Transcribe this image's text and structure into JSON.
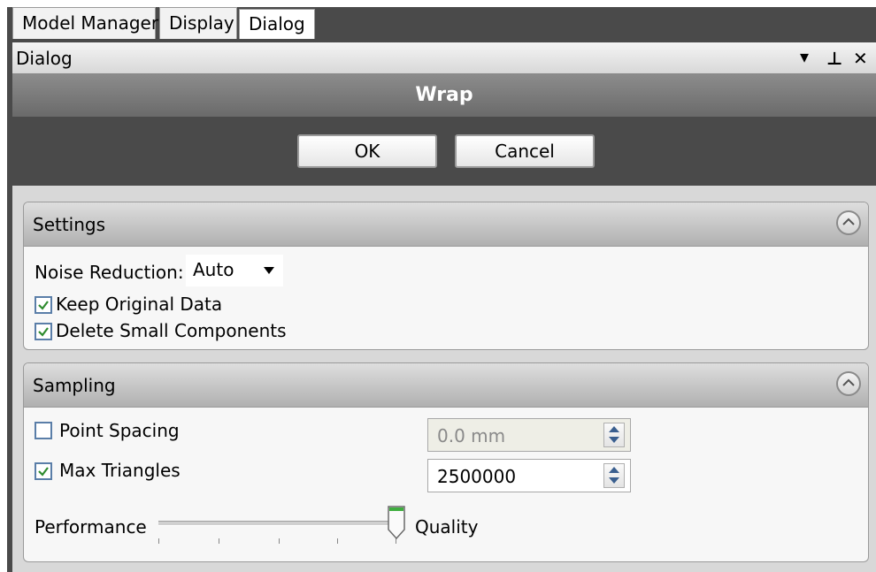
{
  "tabs": [
    {
      "label": "Model Manager"
    },
    {
      "label": "Display"
    },
    {
      "label": "Dialog"
    }
  ],
  "window": {
    "title": "Dialog",
    "dropdown_glyph": "▾",
    "pin_glyph": "⊥",
    "close_glyph": "✕"
  },
  "dialog": {
    "title": "Wrap"
  },
  "buttons": {
    "ok_label": "OK",
    "cancel_label": "Cancel"
  },
  "settings": {
    "header": "Settings",
    "noise_reduction": {
      "label": "Noise Reduction:",
      "value": "Auto"
    },
    "keep_original_data": {
      "label": "Keep Original Data",
      "checked": true
    },
    "delete_small_components": {
      "label": "Delete Small Components",
      "checked": true
    }
  },
  "sampling": {
    "header": "Sampling",
    "point_spacing": {
      "label": "Point Spacing",
      "checked": false,
      "value": "0.0 mm",
      "enabled": false
    },
    "max_triangles": {
      "label": "Max Triangles",
      "checked": true,
      "value": "2500000",
      "enabled": true
    },
    "slider": {
      "left_label": "Performance",
      "right_label": "Quality",
      "value": 1.0
    }
  },
  "colors": {
    "frame": "#4a4a4a",
    "accent_check": "#2e8b2e",
    "header_bar": "#7a7a7a"
  }
}
